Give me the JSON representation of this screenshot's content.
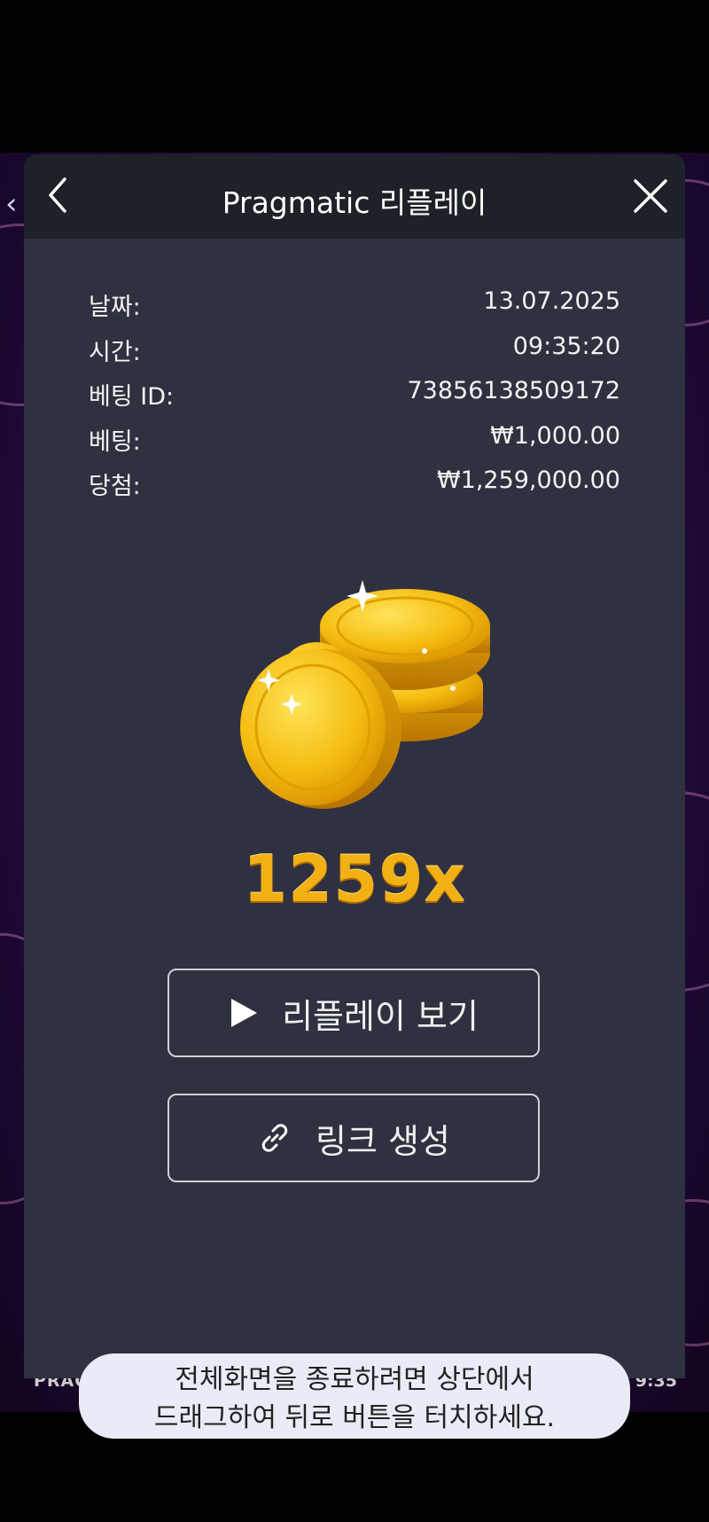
{
  "header": {
    "title": "Pragmatic 리플레이"
  },
  "details": [
    {
      "label": "날짜:",
      "value": "13.07.2025"
    },
    {
      "label": "시간:",
      "value": "09:35:20"
    },
    {
      "label": "베팅 ID:",
      "value": "73856138509172"
    },
    {
      "label": "베팅:",
      "value": "₩1,000.00"
    },
    {
      "label": "당첨:",
      "value": "₩1,259,000.00"
    }
  ],
  "win": {
    "multiplier": "1259x"
  },
  "buttons": {
    "replay_label": "리플레이 보기",
    "link_label": "링크 생성"
  },
  "background": {
    "footer_left": "PRAG",
    "footer_right": "9:35"
  },
  "toast": {
    "line1": "전체화면을 종료하려면 상단에서",
    "line2": "드래그하여 뒤로 버튼을 터치하세요."
  },
  "icons": {
    "back": "chevron-left-icon",
    "close": "close-icon",
    "play": "play-icon",
    "link": "link-icon",
    "coins": "gold-coins-icon"
  },
  "colors": {
    "panel_bg": "#2f3140",
    "header_bg": "#1f2129",
    "accent_gold": "#f2b014"
  }
}
